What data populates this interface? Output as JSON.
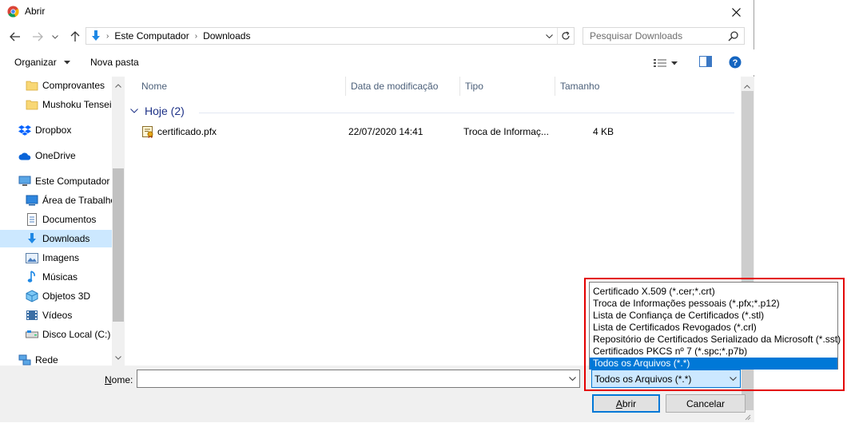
{
  "window": {
    "title": "Abrir"
  },
  "address": {
    "crumbs": [
      "Este Computador",
      "Downloads"
    ]
  },
  "search": {
    "placeholder": "Pesquisar Downloads"
  },
  "toolbar": {
    "organize_label": "Organizar",
    "new_folder_label": "Nova pasta"
  },
  "sidebar": {
    "items": [
      {
        "label": "Comprovantes",
        "icon": "folder-icon"
      },
      {
        "label": "Mushoku Tensei",
        "icon": "folder-icon"
      },
      {
        "label": "Dropbox",
        "icon": "dropbox-icon"
      },
      {
        "label": "OneDrive",
        "icon": "onedrive-icon"
      },
      {
        "label": "Este Computador",
        "icon": "computer-icon"
      },
      {
        "label": "Área de Trabalho",
        "icon": "desktop-icon"
      },
      {
        "label": "Documentos",
        "icon": "documents-icon"
      },
      {
        "label": "Downloads",
        "icon": "download-icon"
      },
      {
        "label": "Imagens",
        "icon": "pictures-icon"
      },
      {
        "label": "Músicas",
        "icon": "music-icon"
      },
      {
        "label": "Objetos 3D",
        "icon": "objects-3d-icon"
      },
      {
        "label": "Vídeos",
        "icon": "videos-icon"
      },
      {
        "label": "Disco Local (C:)",
        "icon": "drive-icon"
      },
      {
        "label": "Rede",
        "icon": "network-icon"
      }
    ],
    "selected": "Downloads"
  },
  "file_list": {
    "columns": [
      "Nome",
      "Data de modificação",
      "Tipo",
      "Tamanho"
    ],
    "group": {
      "label": "Hoje (2)"
    },
    "rows": [
      {
        "name": "certificado.pfx",
        "modified": "22/07/2020 14:41",
        "type": "Troca de Informaç...",
        "size": "4 KB",
        "icon": "certificate-file-icon"
      }
    ]
  },
  "bottom": {
    "name_label": "Nome:",
    "name_value": "",
    "file_type_selected": "Todos os Arquivos (*.*)",
    "file_type_options": [
      "Certificado X.509 (*.cer;*.crt)",
      "Troca de Informações pessoais (*.pfx;*.p12)",
      "Lista de Confiança de Certificados (*.stl)",
      "Lista de Certificados Revogados (*.crl)",
      "Repositório de Certificados Serializado da Microsoft (*.sst)",
      "Certificados PKCS nº 7 (*.spc;*.p7b)",
      "Todos os Arquivos (*.*)"
    ],
    "open_label": "Abrir",
    "cancel_label": "Cancelar"
  },
  "colors": {
    "accent": "#0078d7",
    "selection": "#cce8ff",
    "highlight_border": "#e30000",
    "group_text": "#1e3287"
  }
}
